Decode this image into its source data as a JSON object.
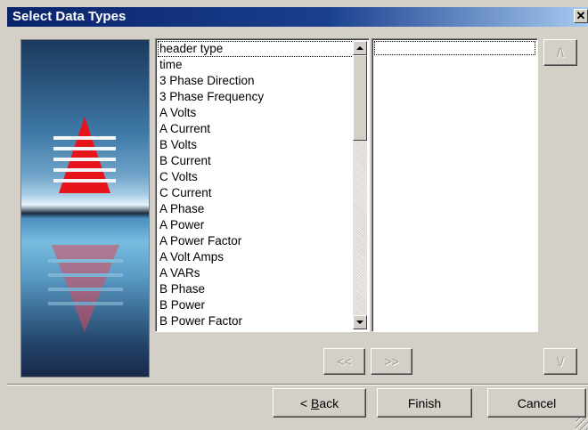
{
  "window": {
    "title": "Select Data Types",
    "close_glyph": "✕"
  },
  "available_list": {
    "items": [
      "header type",
      "time",
      "3 Phase Direction",
      "3 Phase Frequency",
      "A Volts",
      "A Current",
      "B Volts",
      "B Current",
      "C Volts",
      "C Current",
      "A Phase",
      "A Power",
      "A Power Factor",
      "A Volt Amps",
      "A VARs",
      "B Phase",
      "B Power",
      "B Power Factor"
    ]
  },
  "selected_list": {
    "items": []
  },
  "buttons": {
    "move_up": "/\\",
    "move_down": "\\/",
    "remove": "<<",
    "add": ">>",
    "back": "< Back",
    "back_mnemonic": "B",
    "finish": "Finish",
    "cancel": "Cancel"
  },
  "colors": {
    "titlebar_start": "#0a246a",
    "titlebar_end": "#a6caf0",
    "logo_red": "#e8141c",
    "dialog_bg": "#d4d0c8"
  },
  "icons": {
    "banner_logo": "red-triangle-logo",
    "scroll_up": "scroll-up-arrow",
    "scroll_down": "scroll-down-arrow"
  }
}
